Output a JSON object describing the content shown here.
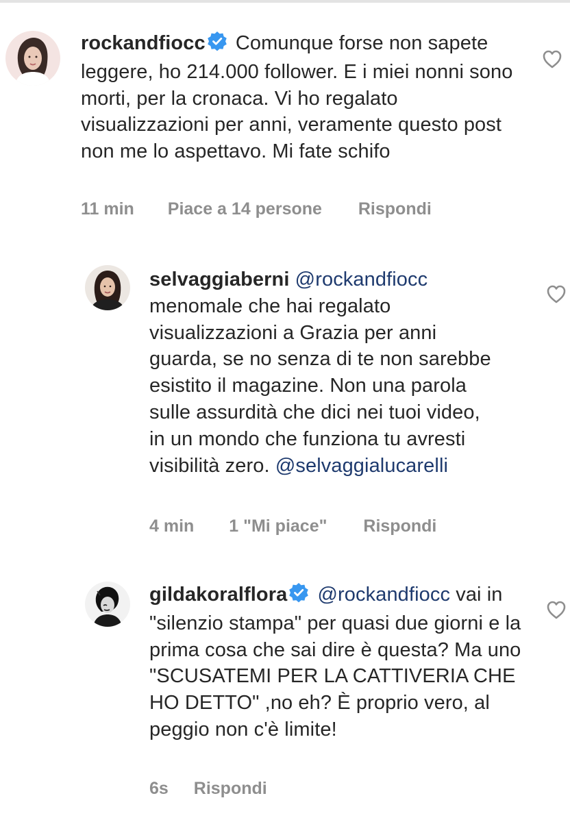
{
  "colors": {
    "username": "#262626",
    "text": "#262626",
    "meta": "#8e8e8e",
    "mention": "#1e3a6e",
    "verified": "#3897f0"
  },
  "comments": [
    {
      "username": "rockandfiocc",
      "verified": true,
      "mention": "",
      "text": "Comunque forse non sapete leggere, ho 214.000 follower. E i miei nonni sono morti, per la cronaca. Vi ho regalato visualizzazioni per anni, veramente questo post non me lo aspettavo. Mi fate schifo",
      "trailing_mention": "",
      "time": "11 min",
      "likes": "Piace a 14 persone",
      "reply": "Rispondi",
      "avatar_icon": "profile-photo",
      "like_icon": "heart-outline-icon"
    },
    {
      "username": "selvaggiaberni",
      "verified": false,
      "mention": "@rockandfiocc",
      "text": "menomale che hai regalato visualizzazioni a Grazia per anni guarda, se no senza di te non sarebbe esistito il magazine. Non una parola sulle assurdità che dici nei tuoi video, in un mondo che funziona tu avresti visibilità zero.",
      "trailing_mention": "@selvaggialucarelli",
      "time": "4 min",
      "likes": "1 \"Mi piace\"",
      "reply": "Rispondi",
      "avatar_icon": "profile-photo",
      "like_icon": "heart-outline-icon"
    },
    {
      "username": "gildakoralflora",
      "verified": true,
      "mention": "@rockandfiocc",
      "text": "vai in \"silenzio stampa\" per quasi due giorni e la prima cosa che sai dire è questa? Ma uno \"SCUSATEMI PER LA CATTIVERIA CHE HO DETTO\" ,no eh? È proprio vero, al peggio non c'è limite!",
      "trailing_mention": "",
      "time": "6s",
      "likes": "",
      "reply": "Rispondi",
      "avatar_icon": "profile-photo",
      "like_icon": "heart-outline-icon"
    }
  ]
}
